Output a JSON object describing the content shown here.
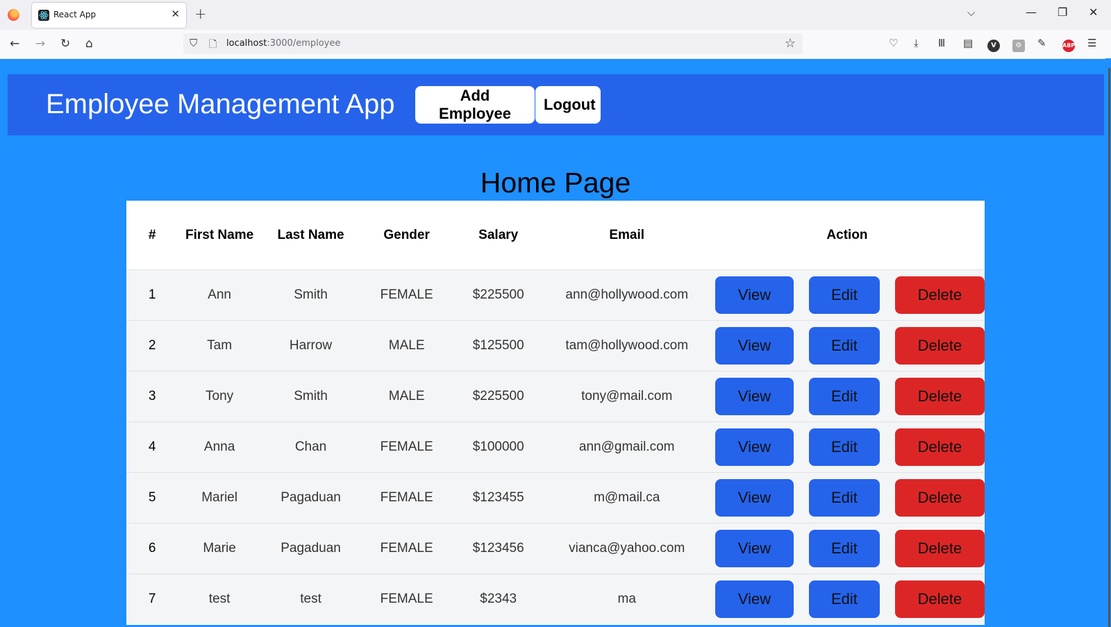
{
  "browser": {
    "tab_title": "React App",
    "tab_close": "✕",
    "new_tab": "+",
    "list_tabs": "⌵",
    "url_host": "localhost",
    "url_path": ":3000/employee",
    "window_minimize": "—",
    "window_restore": "❐",
    "window_close": "✕"
  },
  "app": {
    "title": "Employee Management App",
    "add_employee_label": "Add Employee",
    "logout_label": "Logout",
    "page_heading": "Home Page"
  },
  "table": {
    "headers": {
      "index": "#",
      "first_name": "First Name",
      "last_name": "Last Name",
      "gender": "Gender",
      "salary": "Salary",
      "email": "Email",
      "action": "Action"
    },
    "actions": {
      "view": "View",
      "edit": "Edit",
      "delete": "Delete"
    },
    "rows": [
      {
        "id": "1",
        "first": "Ann",
        "last": "Smith",
        "gender": "FEMALE",
        "salary": "$225500",
        "email": "ann@hollywood.com"
      },
      {
        "id": "2",
        "first": "Tam",
        "last": "Harrow",
        "gender": "MALE",
        "salary": "$125500",
        "email": "tam@hollywood.com"
      },
      {
        "id": "3",
        "first": "Tony",
        "last": "Smith",
        "gender": "MALE",
        "salary": "$225500",
        "email": "tony@mail.com"
      },
      {
        "id": "4",
        "first": "Anna",
        "last": "Chan",
        "gender": "FEMALE",
        "salary": "$100000",
        "email": "ann@gmail.com"
      },
      {
        "id": "5",
        "first": "Mariel",
        "last": "Pagaduan",
        "gender": "FEMALE",
        "salary": "$123455",
        "email": "m@mail.ca"
      },
      {
        "id": "6",
        "first": "Marie",
        "last": "Pagaduan",
        "gender": "FEMALE",
        "salary": "$123456",
        "email": "vianca@yahoo.com"
      },
      {
        "id": "7",
        "first": "test",
        "last": "test",
        "gender": "FEMALE",
        "salary": "$2343",
        "email": "ma"
      }
    ]
  },
  "colors": {
    "page_bg": "#1e90ff",
    "header_bg": "#2563eb",
    "view_edit_bg": "#2563eb",
    "delete_bg": "#dc2626"
  }
}
